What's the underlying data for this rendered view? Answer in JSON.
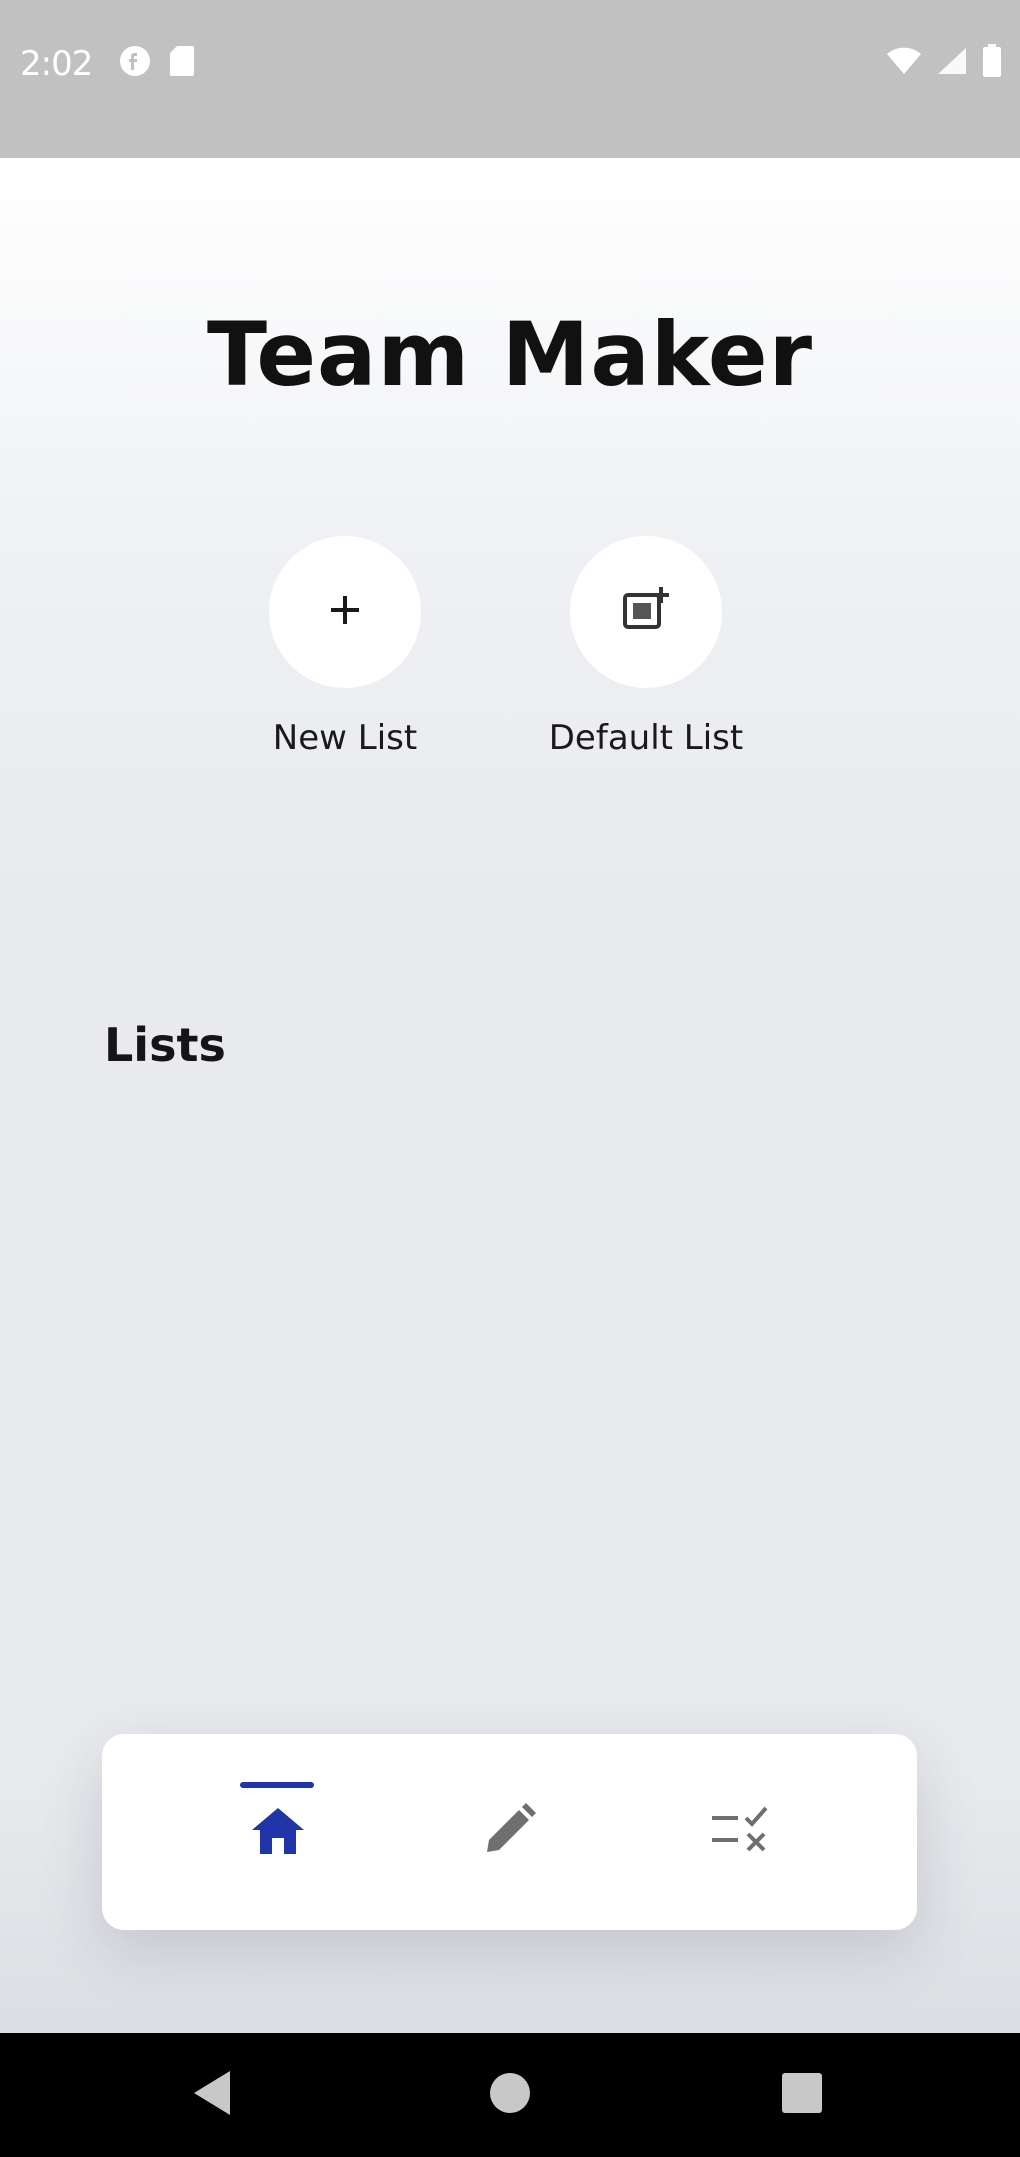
{
  "status_bar": {
    "time": "2:02",
    "left_icons": [
      "f-info-icon",
      "sd-card-icon"
    ],
    "right_icons": [
      "wifi-icon",
      "cell-signal-icon",
      "battery-icon"
    ]
  },
  "app": {
    "title": "Team Maker",
    "actions": [
      {
        "label": "New List",
        "icon": "plus-icon"
      },
      {
        "label": "Default List",
        "icon": "add-photo-icon"
      }
    ],
    "section_title": "Lists",
    "lists": [],
    "bottom_nav": {
      "items": [
        {
          "icon": "home-icon",
          "active": true
        },
        {
          "icon": "pencil-icon",
          "active": false
        },
        {
          "icon": "checklist-icon",
          "active": false
        }
      ]
    }
  },
  "system_nav": {
    "buttons": [
      "back-icon",
      "home-circle-icon",
      "recents-icon"
    ]
  },
  "colors": {
    "status_bar": "#c1c1c1",
    "background": "#e8eaee",
    "accent": "#1f35a8",
    "inactive_icon": "#6f6f6f",
    "system_nav": "#000000"
  }
}
